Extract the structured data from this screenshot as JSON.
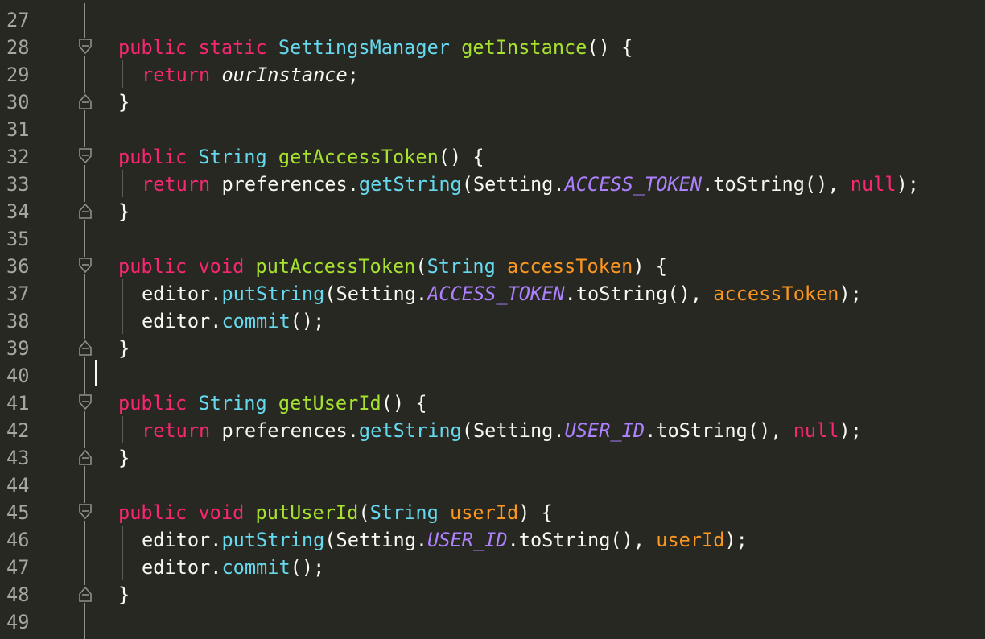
{
  "editor": {
    "theme_colors": {
      "background": "#272822",
      "keyword": "#f92672",
      "type": "#66d9ef",
      "function": "#a6e22e",
      "parameter": "#fd971f",
      "constant": "#ae81ff",
      "text": "#f8f8f2",
      "line_number": "#a7a7a0"
    },
    "lines": [
      {
        "num": "27"
      },
      {
        "num": "28",
        "fold": "fold-open-icon",
        "t": [
          {
            "text": "public",
            "c": "kw"
          },
          {
            "text": " "
          },
          {
            "text": "static",
            "c": "kw"
          },
          {
            "text": " "
          },
          {
            "text": "SettingsManager",
            "c": "ty"
          },
          {
            "text": " "
          },
          {
            "text": "getInstance",
            "c": "fn"
          },
          {
            "text": "() {"
          }
        ]
      },
      {
        "num": "29",
        "guide": true,
        "indent": 2,
        "t": [
          {
            "text": "return",
            "c": "kw"
          },
          {
            "text": " "
          },
          {
            "text": "ourInstance",
            "c": "field"
          },
          {
            "text": ";"
          }
        ]
      },
      {
        "num": "30",
        "fold": "fold-close-icon",
        "t": [
          {
            "text": "}"
          }
        ]
      },
      {
        "num": "31"
      },
      {
        "num": "32",
        "fold": "fold-open-icon",
        "t": [
          {
            "text": "public",
            "c": "kw"
          },
          {
            "text": " "
          },
          {
            "text": "String",
            "c": "ty"
          },
          {
            "text": " "
          },
          {
            "text": "getAccessToken",
            "c": "fn"
          },
          {
            "text": "() {"
          }
        ]
      },
      {
        "num": "33",
        "guide": true,
        "indent": 2,
        "t": [
          {
            "text": "return",
            "c": "kw"
          },
          {
            "text": " preferences."
          },
          {
            "text": "getString",
            "c": "ty"
          },
          {
            "text": "(Setting."
          },
          {
            "text": "ACCESS_TOKEN",
            "c": "const"
          },
          {
            "text": ".toString(), "
          },
          {
            "text": "null",
            "c": "kw"
          },
          {
            "text": ");"
          }
        ]
      },
      {
        "num": "34",
        "fold": "fold-close-icon",
        "t": [
          {
            "text": "}"
          }
        ]
      },
      {
        "num": "35"
      },
      {
        "num": "36",
        "fold": "fold-open-icon",
        "t": [
          {
            "text": "public",
            "c": "kw"
          },
          {
            "text": " "
          },
          {
            "text": "void",
            "c": "kw"
          },
          {
            "text": " "
          },
          {
            "text": "putAccessToken",
            "c": "fn"
          },
          {
            "text": "("
          },
          {
            "text": "String",
            "c": "ty"
          },
          {
            "text": " "
          },
          {
            "text": "accessToken",
            "c": "param"
          },
          {
            "text": ") {"
          }
        ]
      },
      {
        "num": "37",
        "guide": true,
        "indent": 2,
        "t": [
          {
            "text": "editor."
          },
          {
            "text": "putString",
            "c": "ty"
          },
          {
            "text": "(Setting."
          },
          {
            "text": "ACCESS_TOKEN",
            "c": "const"
          },
          {
            "text": ".toString(), "
          },
          {
            "text": "accessToken",
            "c": "param"
          },
          {
            "text": ");"
          }
        ]
      },
      {
        "num": "38",
        "guide": true,
        "indent": 2,
        "t": [
          {
            "text": "editor."
          },
          {
            "text": "commit",
            "c": "ty"
          },
          {
            "text": "();"
          }
        ]
      },
      {
        "num": "39",
        "fold": "fold-close-icon",
        "t": [
          {
            "text": "}"
          }
        ]
      },
      {
        "num": "40"
      },
      {
        "num": "41",
        "fold": "fold-open-icon",
        "t": [
          {
            "text": "public",
            "c": "kw"
          },
          {
            "text": " "
          },
          {
            "text": "String",
            "c": "ty"
          },
          {
            "text": " "
          },
          {
            "text": "getUserId",
            "c": "fn"
          },
          {
            "text": "() {"
          }
        ]
      },
      {
        "num": "42",
        "guide": true,
        "indent": 2,
        "t": [
          {
            "text": "return",
            "c": "kw"
          },
          {
            "text": " preferences."
          },
          {
            "text": "getString",
            "c": "ty"
          },
          {
            "text": "(Setting."
          },
          {
            "text": "USER_ID",
            "c": "const"
          },
          {
            "text": ".toString(), "
          },
          {
            "text": "null",
            "c": "kw"
          },
          {
            "text": ");"
          }
        ]
      },
      {
        "num": "43",
        "fold": "fold-close-icon",
        "t": [
          {
            "text": "}"
          }
        ]
      },
      {
        "num": "44"
      },
      {
        "num": "45",
        "fold": "fold-open-icon",
        "t": [
          {
            "text": "public",
            "c": "kw"
          },
          {
            "text": " "
          },
          {
            "text": "void",
            "c": "kw"
          },
          {
            "text": " "
          },
          {
            "text": "putUserId",
            "c": "fn"
          },
          {
            "text": "("
          },
          {
            "text": "String",
            "c": "ty"
          },
          {
            "text": " "
          },
          {
            "text": "userId",
            "c": "param"
          },
          {
            "text": ") {"
          }
        ]
      },
      {
        "num": "46",
        "guide": true,
        "indent": 2,
        "t": [
          {
            "text": "editor."
          },
          {
            "text": "putString",
            "c": "ty"
          },
          {
            "text": "(Setting."
          },
          {
            "text": "USER_ID",
            "c": "const"
          },
          {
            "text": ".toString(), "
          },
          {
            "text": "userId",
            "c": "param"
          },
          {
            "text": ");"
          }
        ]
      },
      {
        "num": "47",
        "guide": true,
        "indent": 2,
        "t": [
          {
            "text": "editor."
          },
          {
            "text": "commit",
            "c": "ty"
          },
          {
            "text": "();"
          }
        ]
      },
      {
        "num": "48",
        "fold": "fold-close-icon",
        "t": [
          {
            "text": "}"
          }
        ]
      },
      {
        "num": "49"
      }
    ]
  }
}
